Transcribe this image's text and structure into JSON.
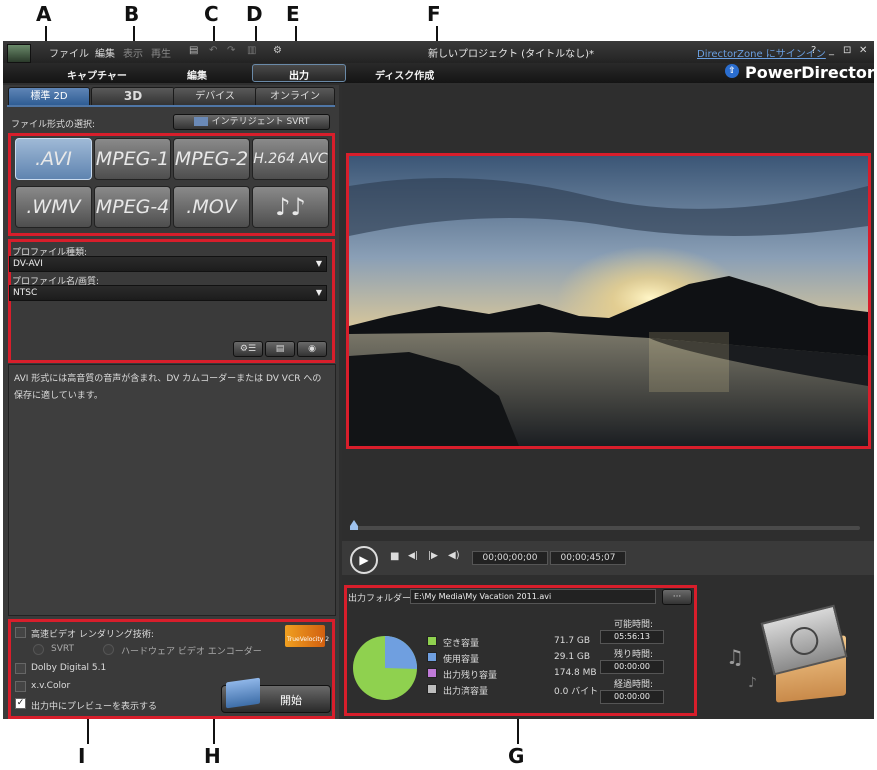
{
  "callouts": [
    "A",
    "B",
    "C",
    "D",
    "E",
    "F",
    "G",
    "H",
    "I"
  ],
  "titlebar": {
    "menu": [
      "ファイル",
      "編集",
      "表示",
      "再生"
    ],
    "project_title": "新しいプロジェクト (タイトルなし)*",
    "signin": "DirectorZone にサインイン",
    "help": "?",
    "min": "_",
    "max": "⊡",
    "close": "✕"
  },
  "nav": {
    "capture": "キャプチャー",
    "edit": "編集",
    "output": "出力",
    "disc": "ディスク作成",
    "brand": "PowerDirector"
  },
  "tabs": [
    "標準 2D",
    "3D",
    "デバイス",
    "オンライン"
  ],
  "format": {
    "label": "ファイル形式の選択:",
    "svrt_button": "インテリジェント SVRT",
    "buttons": [
      ".AVI",
      "MPEG-1",
      "MPEG-2",
      "H.264 AVC",
      ".WMV",
      "MPEG-4",
      ".MOV",
      "♪♪"
    ]
  },
  "profile": {
    "type_label": "プロファイル種類:",
    "type_value": "DV-AVI",
    "name_label": "プロファイル名/画質:",
    "name_value": "NTSC"
  },
  "description": "AVI 形式には高音質の音声が含まれ、DV カムコーダーまたは DV VCR への保存に適しています。",
  "options": {
    "fast_render": "高速ビデオ レンダリング技術:",
    "svrt": "SVRT",
    "hw_encoder": "ハードウェア ビデオ エンコーダー",
    "dolby": "Dolby Digital 5.1",
    "xvcolor": "x.v.Color",
    "preview": "出力中にプレビューを表示する",
    "truevelocity": "TrueVelocity 2"
  },
  "start_button": "開始",
  "player": {
    "timecode_current": "00;00;00;00",
    "timecode_total": "00;00;45;07"
  },
  "output": {
    "folder_label": "出力フォルダー:",
    "folder_value": "E:\\My Media\\My Vacation 2011.avi",
    "browse": "···",
    "legend": [
      {
        "label": "空き容量",
        "value": "71.7  GB",
        "color": "#8fd14f"
      },
      {
        "label": "使用容量",
        "value": "29.1  GB",
        "color": "#6f9fe0"
      },
      {
        "label": "出力残り容量",
        "value": "174.8  MB",
        "color": "#c07ad8"
      },
      {
        "label": "出力済容量",
        "value": "0.0  バイト",
        "color": "#bdbdbd"
      }
    ],
    "available_label": "可能時間:",
    "available_value": "05:56:13",
    "remaining_label": "残り時間:",
    "remaining_value": "00:00:00",
    "elapsed_label": "経過時間:",
    "elapsed_value": "00:00:00"
  },
  "colors": {
    "accent_red": "#d81e2b",
    "tab_blue": "#2f5d94",
    "pie_free": "#8fd14f",
    "pie_used": "#6f9fe0"
  }
}
